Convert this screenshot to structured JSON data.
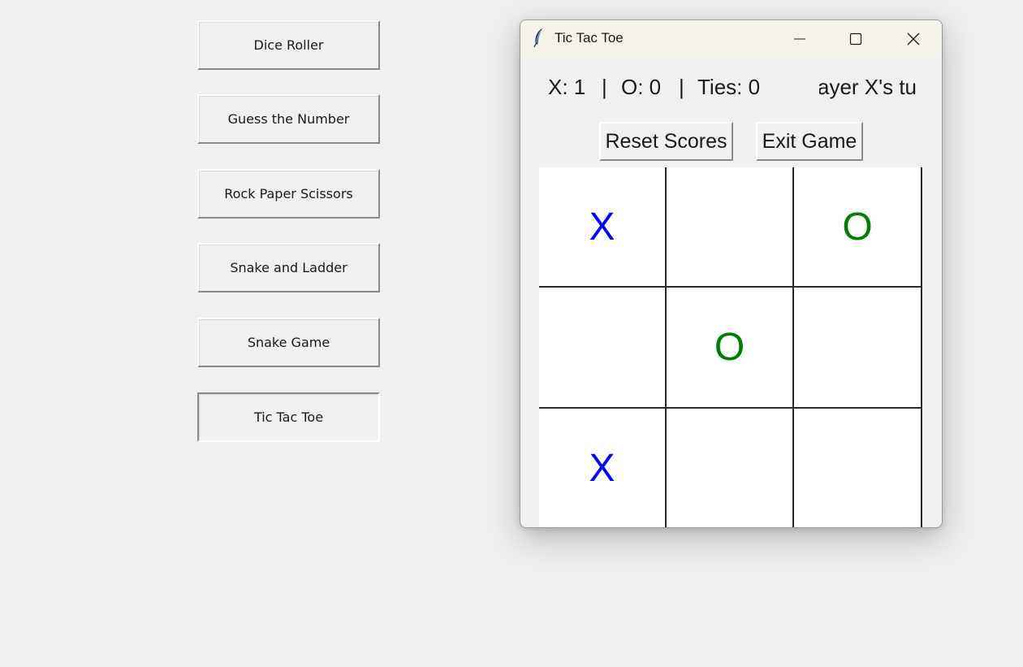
{
  "menu": {
    "buttons": [
      {
        "label": "Dice Roller"
      },
      {
        "label": "Guess the Number"
      },
      {
        "label": "Rock Paper Scissors"
      },
      {
        "label": "Snake and Ladder"
      },
      {
        "label": "Snake Game"
      },
      {
        "label": "Tic Tac Toe"
      }
    ]
  },
  "window": {
    "title": "Tic Tac Toe",
    "icon": "feather-icon"
  },
  "status": {
    "x_score": "X: 1",
    "o_score": "O: 0",
    "ties": "Ties: 0",
    "separator": "|",
    "turn": "ayer X's tu"
  },
  "actions": {
    "reset_label": "Reset Scores",
    "exit_label": "Exit Game"
  },
  "board": {
    "cells": [
      "X",
      "",
      "O",
      "",
      "O",
      "",
      "X",
      "",
      ""
    ]
  },
  "colors": {
    "x": "#0000ff",
    "o": "#008000"
  }
}
